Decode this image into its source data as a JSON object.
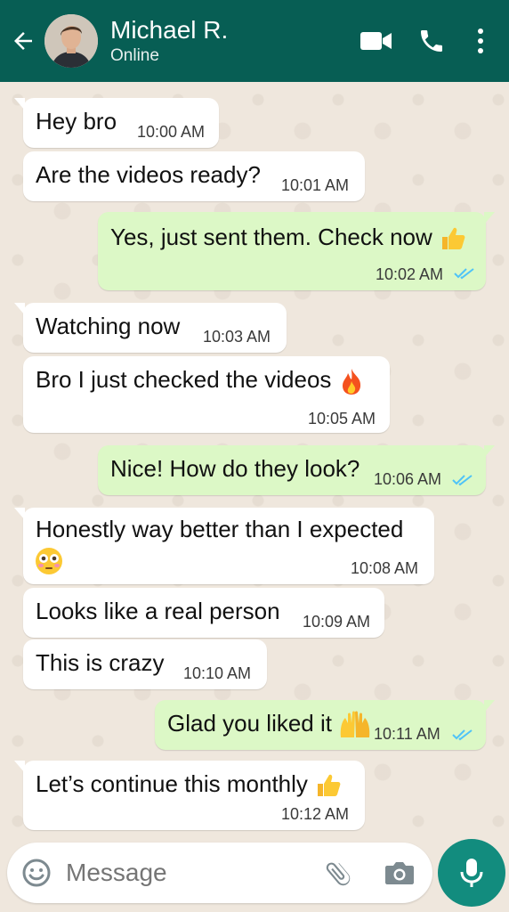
{
  "header": {
    "name": "Michael R.",
    "status": "Online"
  },
  "icons": {
    "back": "arrow-back-icon",
    "video": "video-call-icon",
    "call": "phone-icon",
    "menu": "more-vert-icon",
    "emoji": "emoji-icon",
    "attach": "paperclip-icon",
    "camera": "camera-icon",
    "mic": "microphone-icon"
  },
  "colors": {
    "header": "#075e54",
    "outgoing": "#dcf8c6",
    "incoming": "#ffffff",
    "ticks": "#4fc3f7",
    "send": "#128c7e"
  },
  "messages": [
    {
      "dir": "in",
      "text": "Hey bro",
      "time": "10:00 AM"
    },
    {
      "dir": "in",
      "text": "Are the videos ready?",
      "time": "10:01 AM"
    },
    {
      "dir": "out",
      "text": "Yes, just sent them. Check now",
      "emoji": "thumbs-up",
      "time": "10:02 AM",
      "read": true
    },
    {
      "dir": "in",
      "text": "Watching now",
      "time": "10:03 AM"
    },
    {
      "dir": "in",
      "text": "Bro I just checked the videos",
      "emoji": "fire",
      "time": "10:05 AM"
    },
    {
      "dir": "out",
      "text": "Nice! How do they look?",
      "time": "10:06 AM",
      "read": true
    },
    {
      "dir": "in",
      "text": "Honestly way better than I expected",
      "emoji": "flushed-face",
      "time": "10:08 AM"
    },
    {
      "dir": "in",
      "text": "Looks like a real person",
      "time": "10:09 AM"
    },
    {
      "dir": "in",
      "text": "This is crazy",
      "time": "10:10 AM"
    },
    {
      "dir": "out",
      "text": "Glad you liked it",
      "emoji": "raising-hands",
      "time": "10:11 AM",
      "read": true
    },
    {
      "dir": "in",
      "text": "Let’s continue this monthly",
      "emoji": "thumbs-up",
      "time": "10:12 AM"
    }
  ],
  "composer": {
    "placeholder": "Message"
  }
}
